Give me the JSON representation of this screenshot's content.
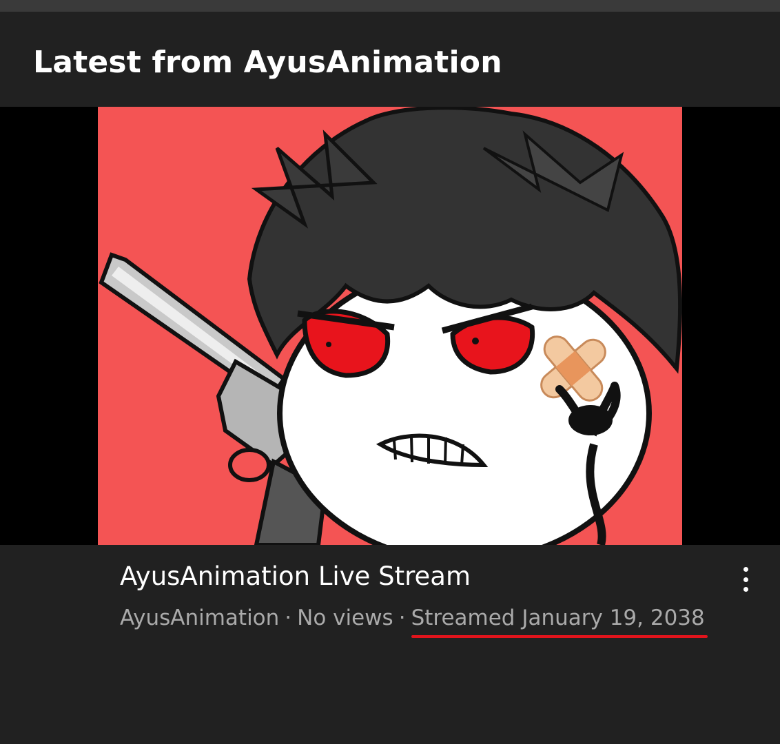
{
  "header": {
    "title": "Latest from AyusAnimation"
  },
  "video": {
    "title": "AyusAnimation Live Stream",
    "channel": "AyusAnimation",
    "views": "No views",
    "separator": "·",
    "streamed": "Streamed January 19, 2038",
    "more_icon": "more-vert-icon"
  },
  "thumbnail": {
    "subject": "cartoon character with red eyes, bandage and revolver",
    "background_color": "#f45454"
  },
  "colors": {
    "page_background": "#212121",
    "top_strip": "#3a3a3a",
    "player_background": "#000000",
    "meta_text": "#aaaaaa",
    "highlight_underline": "#e0141c"
  }
}
